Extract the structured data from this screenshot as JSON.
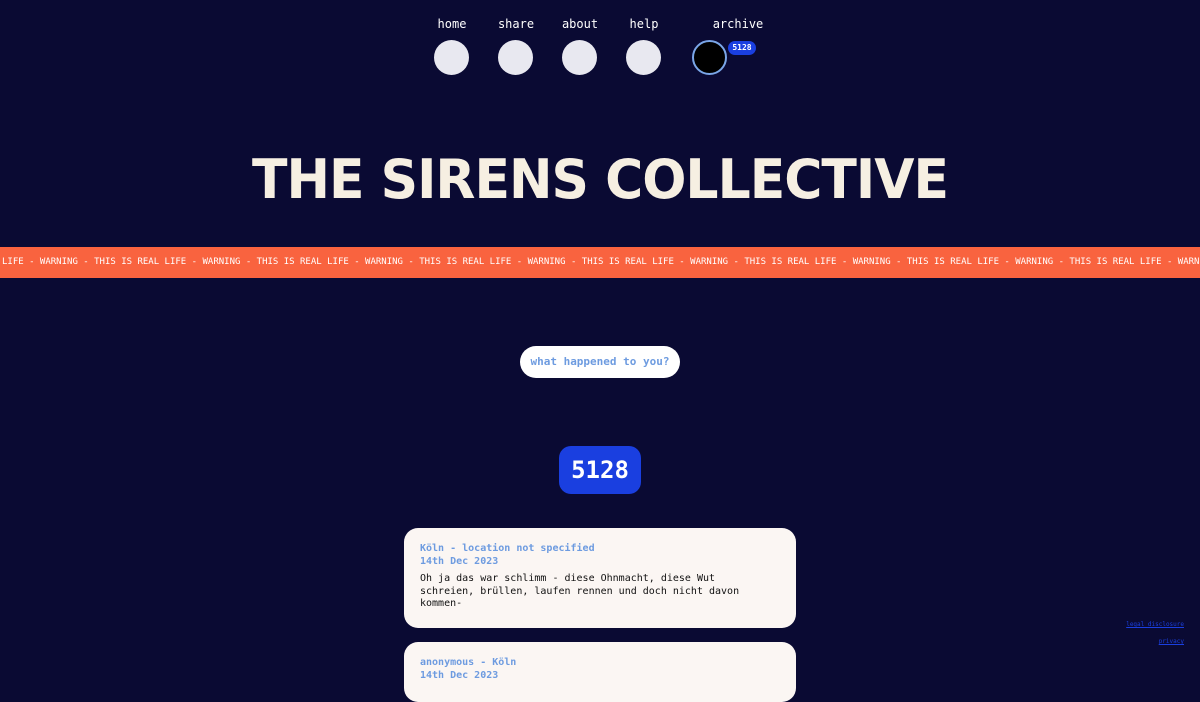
{
  "nav": {
    "items": [
      {
        "label": "home"
      },
      {
        "label": "share"
      },
      {
        "label": "about"
      },
      {
        "label": "help"
      },
      {
        "label": "archive",
        "badge": "5128"
      }
    ]
  },
  "title": "THE SIRENS COLLECTIVE",
  "ticker": {
    "text": "LIFE - WARNING - THIS IS REAL LIFE - WARNING - THIS IS REAL LIFE - WARNING - THIS IS REAL LIFE - WARNING - THIS IS REAL LIFE - WARNING - THIS IS REAL LIFE - WARNING - THIS IS REAL LIFE - WARNING - THIS IS REAL LIFE - WARNING - THIS IS REAL LIFE - WARNING - THIS IS"
  },
  "question": "what happened to you?",
  "counter": "5128",
  "stories": [
    {
      "location": "Köln - location not specified",
      "date": "14th Dec 2023",
      "text": "Oh ja das war schlimm - diese Ohnmacht, diese Wut\nschreien, brüllen, laufen rennen und doch nicht davon\nkommen-"
    },
    {
      "location": "anonymous - Köln",
      "date": "14th Dec 2023",
      "text": ""
    }
  ],
  "footer": {
    "legal": "legal disclosure",
    "privacy": "privacy"
  },
  "colors": {
    "background": "#0a0a33",
    "ticker": "#f9633f",
    "accent": "#1a3fe0",
    "meta_text": "#6d9be0",
    "card": "#fbf6f3",
    "title": "#f6efe2"
  }
}
